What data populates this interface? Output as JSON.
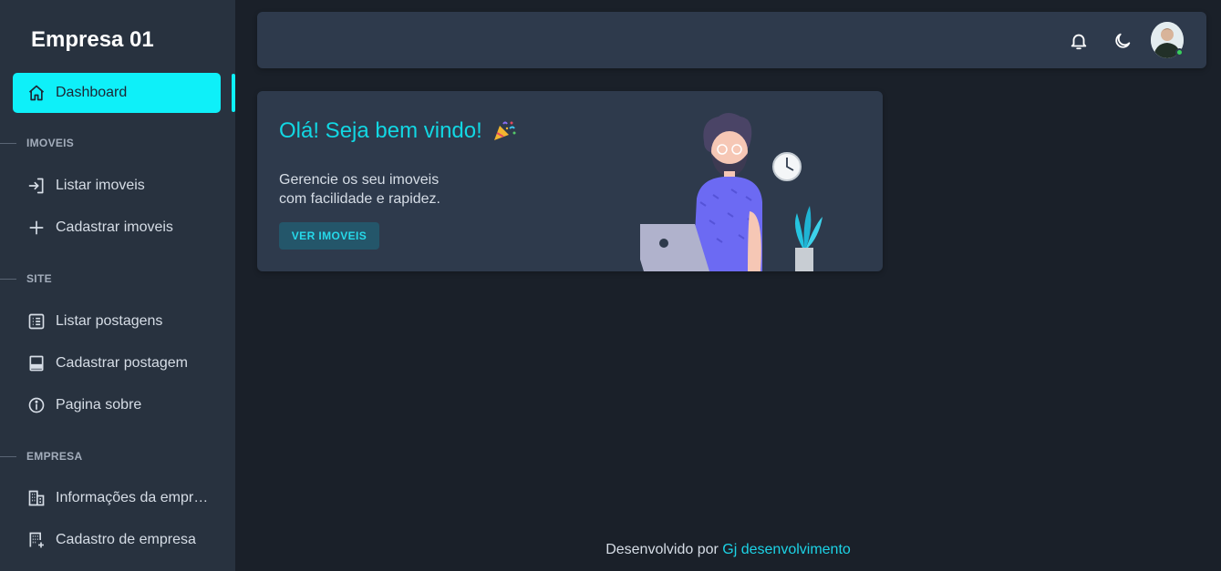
{
  "brand": {
    "name": "Empresa 01"
  },
  "sidebar": {
    "dashboard": {
      "label": "Dashboard",
      "icon": "home-icon"
    },
    "sections": [
      {
        "title": "IMOVEIS"
      },
      {
        "title": "SITE"
      },
      {
        "title": "EMPRESA"
      }
    ],
    "items": [
      {
        "label": "Listar imoveis",
        "icon": "login-icon"
      },
      {
        "label": "Cadastrar imoveis",
        "icon": "plus-icon"
      },
      {
        "label": "Listar postagens",
        "icon": "list-icon"
      },
      {
        "label": "Cadastrar postagem",
        "icon": "panel-icon"
      },
      {
        "label": "Pagina sobre",
        "icon": "info-icon"
      },
      {
        "label": "Informações da empresa",
        "icon": "building-icon"
      },
      {
        "label": "Cadastro de empresa",
        "icon": "building-add-icon"
      }
    ]
  },
  "topbar": {
    "icons": [
      "bell-icon",
      "moon-icon",
      "avatar"
    ],
    "online_status_color": "#39d05c"
  },
  "welcome": {
    "title": "Olá! Seja bem vindo!",
    "title_emoji": "party-popper-icon",
    "desc_line1": "Gerencie os seu imoveis",
    "desc_line2": "com facilidade e rapidez.",
    "button": "VER IMOVEIS"
  },
  "footer": {
    "prefix": "Desenvolvido por",
    "link": "Gj desenvolvimento"
  },
  "colors": {
    "accent": "#0ef0f9",
    "sidebar_bg": "#28323f",
    "page_bg": "#1a2029",
    "card_bg": "#2e3a4c"
  }
}
